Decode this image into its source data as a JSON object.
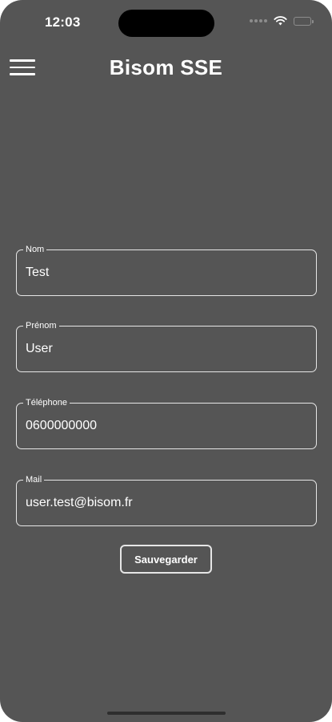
{
  "status_bar": {
    "time": "12:03"
  },
  "header": {
    "title": "Bisom SSE",
    "menu_icon": "hamburger-menu-icon"
  },
  "form": {
    "fields": [
      {
        "label": "Nom",
        "value": "Test"
      },
      {
        "label": "Prénom",
        "value": "User"
      },
      {
        "label": "Téléphone",
        "value": "0600000000"
      },
      {
        "label": "Mail",
        "value": "user.test@bisom.fr"
      }
    ],
    "save_label": "Sauvegarder"
  },
  "colors": {
    "background": "#555555",
    "text": "#ffffff",
    "border": "#e6e6e6"
  }
}
